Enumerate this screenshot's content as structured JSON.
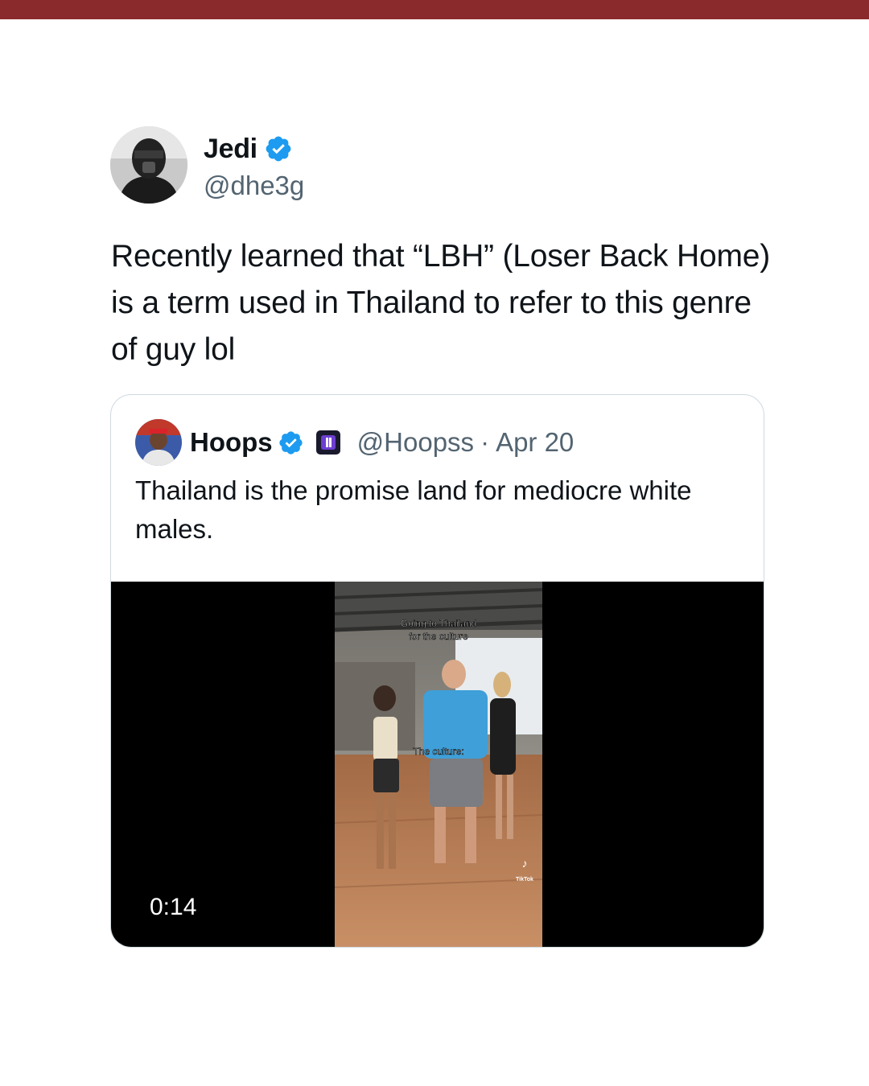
{
  "colors": {
    "top_bar": "#8b2a2d",
    "verified_blue": "#1d9bf0",
    "text": "#0f1419",
    "secondary": "#536471",
    "border": "#cfd9de"
  },
  "tweet": {
    "author": {
      "name": "Jedi",
      "handle": "@dhe3g",
      "verified": true,
      "avatar_icon": "avatar-masked-person"
    },
    "text": "Recently learned that “LBH” (Loser Back Home) is a term used in Thailand to refer to this genre of guy lol"
  },
  "quoted_tweet": {
    "author": {
      "name": "Hoops",
      "handle": "@Hoopss",
      "verified": true,
      "affiliate_badge_icon": "affiliate-badge-icon"
    },
    "separator": "·",
    "date": "Apr 20",
    "text": "Thailand is the promise land for mediocre white males.",
    "video": {
      "duration": "0:14",
      "caption_top_line1": "Going to Thailand",
      "caption_top_line2": "for the culture",
      "caption_mid": "The culture:",
      "watermark": "TikTok"
    }
  }
}
